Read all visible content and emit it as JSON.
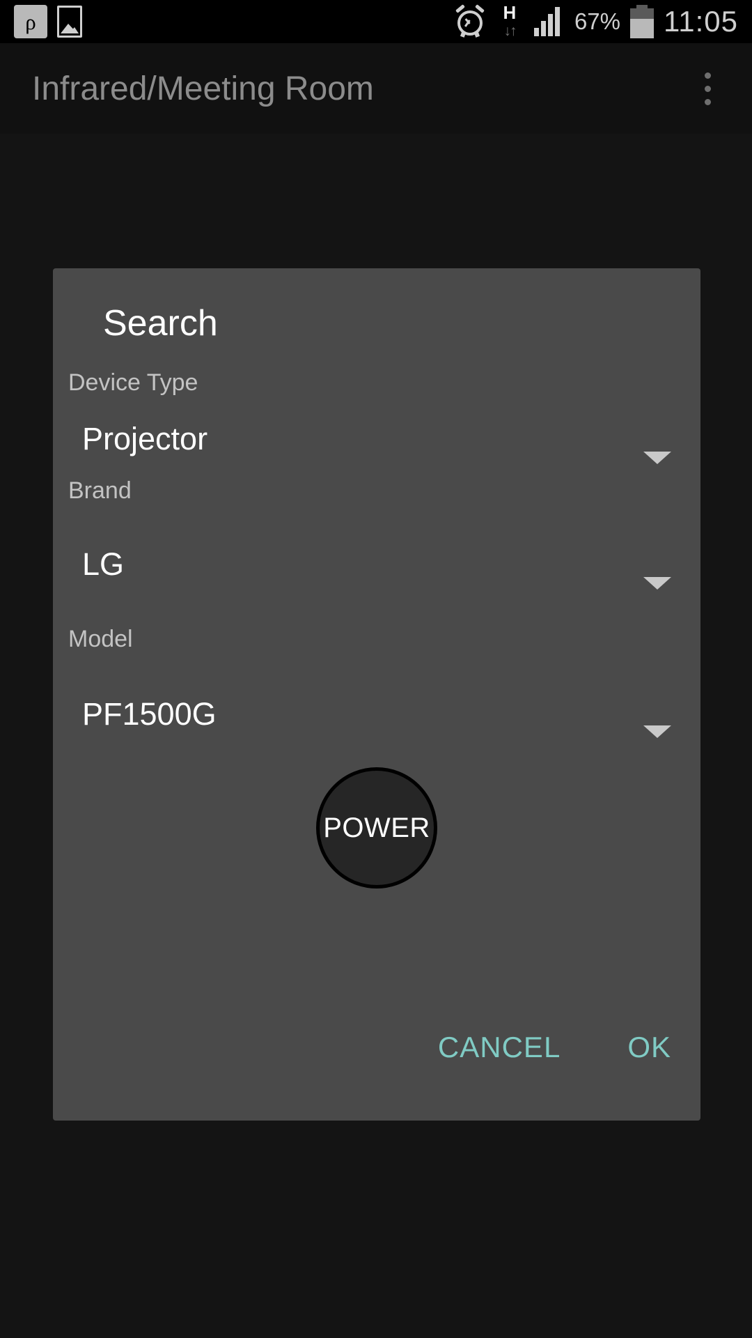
{
  "statusbar": {
    "left_icons": [
      {
        "name": "app-logo-p-icon",
        "glyph": "ρ"
      },
      {
        "name": "image-icon",
        "glyph": "image"
      }
    ],
    "alarm_icon": "alarm-clock-icon",
    "network_type": "H",
    "network_arrows": "↓↑",
    "signal_icon": "signal-bars-icon",
    "signal_bars": 4,
    "battery_percent": "67%",
    "battery_icon": "battery-icon",
    "clock": "11:05"
  },
  "actionbar": {
    "title": "Infrared/Meeting Room",
    "overflow_menu": "more-options"
  },
  "dialog": {
    "title": "Search",
    "fields": [
      {
        "label": "Device Type",
        "value": "Projector"
      },
      {
        "label": "Brand",
        "value": "LG"
      },
      {
        "label": "Model",
        "value": "PF1500G"
      }
    ],
    "power_button": "POWER",
    "actions": {
      "cancel": "CANCEL",
      "ok": "OK"
    }
  },
  "colors": {
    "accent": "#80cbc4",
    "dialog_bg": "#4a4a4a",
    "screen_bg": "#141414",
    "statusbar_bg": "#000000"
  }
}
